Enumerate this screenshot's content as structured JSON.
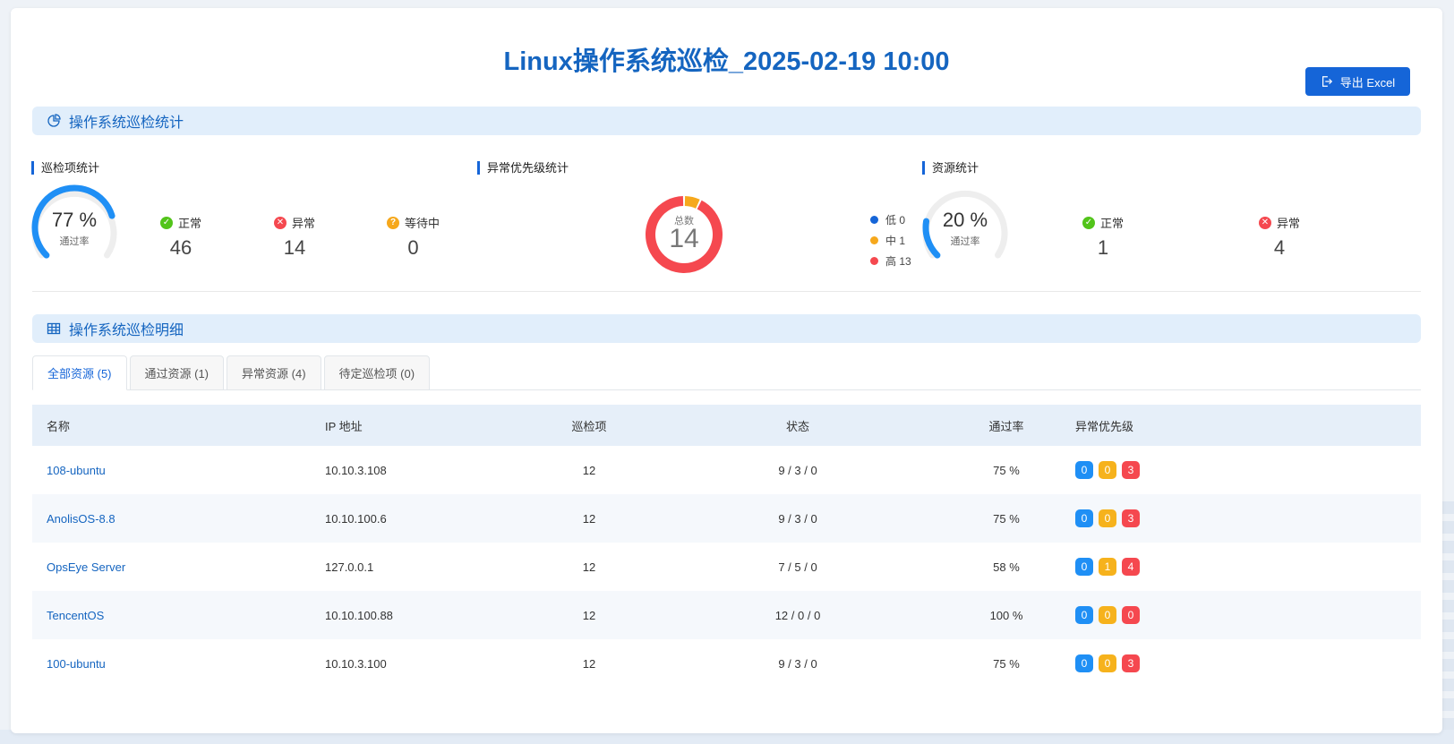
{
  "header": {
    "title": "Linux操作系统巡检_2025-02-19 10:00",
    "export_label": "导出 Excel"
  },
  "stats_section": {
    "title": "操作系统巡检统计",
    "inspection": {
      "title": "巡检项统计",
      "pass_rate": "77 %",
      "pass_rate_fraction": 0.77,
      "pass_rate_label": "通过率",
      "normal_label": "正常",
      "normal": "46",
      "abnormal_label": "异常",
      "abnormal": "14",
      "pending_label": "等待中",
      "pending": "0"
    },
    "priority": {
      "title": "异常优先级统计",
      "total_label": "总数",
      "total": "14",
      "low_label": "低 0",
      "mid_label": "中 1",
      "high_label": "高 13",
      "counts": {
        "low": 0,
        "mid": 1,
        "high": 13
      }
    },
    "resources": {
      "title": "资源统计",
      "pass_rate": "20 %",
      "pass_rate_fraction": 0.2,
      "pass_rate_label": "通过率",
      "normal_label": "正常",
      "normal": "1",
      "abnormal_label": "异常",
      "abnormal": "4"
    }
  },
  "detail_section": {
    "title": "操作系统巡检明细",
    "tabs": [
      "全部资源 (5)",
      "通过资源 (1)",
      "异常资源 (4)",
      "待定巡检项 (0)"
    ],
    "columns": [
      "名称",
      "IP 地址",
      "巡检项",
      "状态",
      "通过率",
      "异常优先级"
    ],
    "rows": [
      {
        "name": "108-ubuntu",
        "ip": "10.10.3.108",
        "items": "12",
        "status": "9 / 3 / 0",
        "rate": "75 %",
        "low": "0",
        "mid": "0",
        "high": "3"
      },
      {
        "name": "AnolisOS-8.8",
        "ip": "10.10.100.6",
        "items": "12",
        "status": "9 / 3 / 0",
        "rate": "75 %",
        "low": "0",
        "mid": "0",
        "high": "3"
      },
      {
        "name": "OpsEye Server",
        "ip": "127.0.0.1",
        "items": "12",
        "status": "7 / 5 / 0",
        "rate": "58 %",
        "low": "0",
        "mid": "1",
        "high": "4"
      },
      {
        "name": "TencentOS",
        "ip": "10.10.100.88",
        "items": "12",
        "status": "12 / 0 / 0",
        "rate": "100 %",
        "low": "0",
        "mid": "0",
        "high": "0"
      },
      {
        "name": "100-ubuntu",
        "ip": "10.10.3.100",
        "items": "12",
        "status": "9 / 3 / 0",
        "rate": "75 %",
        "low": "0",
        "mid": "0",
        "high": "3"
      }
    ]
  },
  "colors": {
    "primary": "#1565d8",
    "title": "#1565c0",
    "normal": "#52c41a",
    "abnormal": "#f5484f",
    "pending": "#f6a81c",
    "low": "#1f8ff5",
    "mid": "#f6b21c",
    "high": "#f5484f"
  }
}
